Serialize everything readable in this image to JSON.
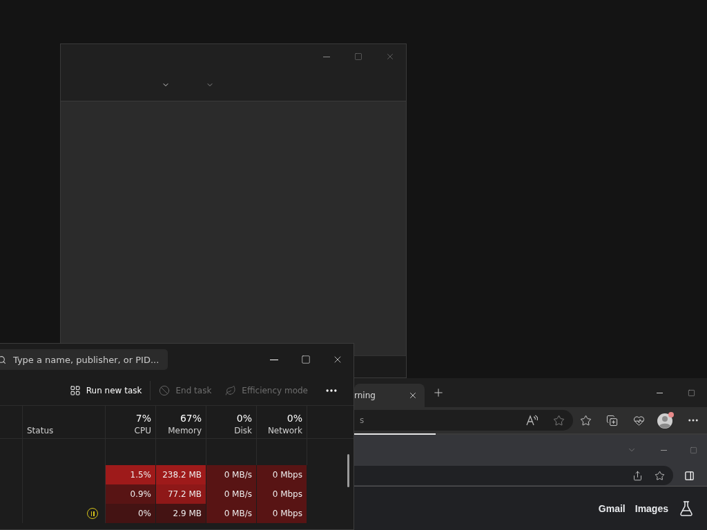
{
  "task_manager": {
    "search": {
      "placeholder": "Type a name, publisher, or PID..."
    },
    "toolbar": [
      {
        "kind": "run",
        "label": "Run new task",
        "disabled": false
      },
      {
        "kind": "end",
        "label": "End task",
        "disabled": true
      },
      {
        "kind": "efficiency",
        "label": "Efficiency mode",
        "disabled": true
      }
    ],
    "status_column": {
      "label": "Status"
    },
    "columns": [
      {
        "usage": "7%",
        "label": "CPU"
      },
      {
        "usage": "67%",
        "label": "Memory"
      },
      {
        "usage": "0%",
        "label": "Disk"
      },
      {
        "usage": "0%",
        "label": "Network"
      }
    ],
    "rows": [
      {
        "suspended": false,
        "cells": [
          {
            "value": "1.5%",
            "color": "#9e1a1a"
          },
          {
            "value": "238.2 MB",
            "color": "#9e1a1a"
          },
          {
            "value": "0 MB/s",
            "color": "#581414"
          },
          {
            "value": "0 Mbps",
            "color": "#581414"
          }
        ]
      },
      {
        "suspended": false,
        "cells": [
          {
            "value": "0.9%",
            "color": "#581414"
          },
          {
            "value": "77.2 MB",
            "color": "#8e1818"
          },
          {
            "value": "0 MB/s",
            "color": "#581414"
          },
          {
            "value": "0 Mbps",
            "color": "#581414"
          }
        ]
      },
      {
        "suspended": true,
        "cells": [
          {
            "value": "0%",
            "color": "#441313"
          },
          {
            "value": "2.9 MB",
            "color": "#441313"
          },
          {
            "value": "0 MB/s",
            "color": "#581414"
          },
          {
            "value": "0 Mbps",
            "color": "#581414"
          }
        ]
      }
    ]
  },
  "edge": {
    "tab": {
      "label": "rning",
      "selected": true
    },
    "address_text": "s",
    "progress": {
      "level": 0.23
    }
  },
  "inner_browser": {
    "links": [
      "Gmail",
      "Images"
    ]
  }
}
